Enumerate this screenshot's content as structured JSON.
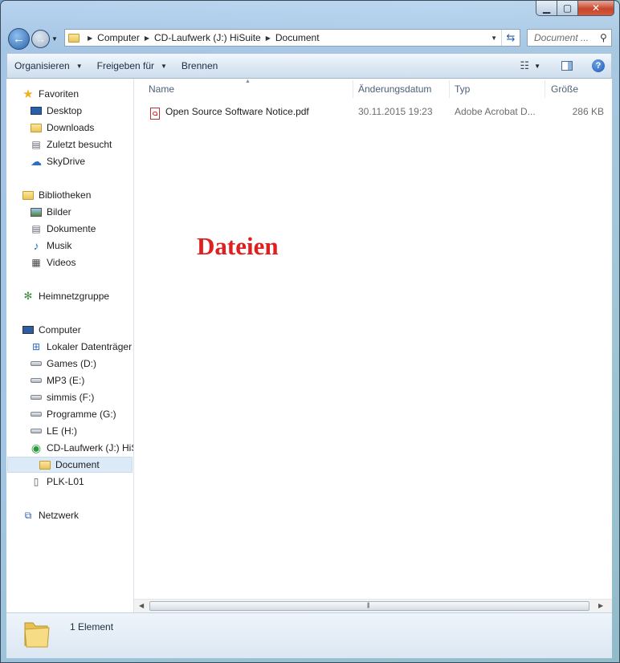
{
  "window": {
    "minimize_icon": "minimize-icon",
    "maximize_icon": "maximize-icon",
    "close_icon": "close-icon"
  },
  "address_bar": {
    "breadcrumbs": [
      "Computer",
      "CD-Laufwerk (J:) HiSuite",
      "Document"
    ]
  },
  "search": {
    "placeholder": "Document ..."
  },
  "toolbar": {
    "organize_label": "Organisieren",
    "share_label": "Freigeben für",
    "burn_label": "Brennen"
  },
  "sidebar": {
    "favorites": {
      "label": "Favoriten",
      "items": [
        "Desktop",
        "Downloads",
        "Zuletzt besucht",
        "SkyDrive"
      ]
    },
    "libraries": {
      "label": "Bibliotheken",
      "items": [
        "Bilder",
        "Dokumente",
        "Musik",
        "Videos"
      ]
    },
    "homegroup": {
      "label": "Heimnetzgruppe"
    },
    "computer": {
      "label": "Computer",
      "items": [
        "Lokaler Datenträger",
        "Games (D:)",
        "MP3 (E:)",
        "simmis (F:)",
        "Programme (G:)",
        "LE (H:)",
        "CD-Laufwerk (J:) HiSuite",
        "Document",
        "PLK-L01"
      ],
      "selected": "Document"
    },
    "network": {
      "label": "Netzwerk"
    }
  },
  "file_list": {
    "columns": [
      "Name",
      "Änderungsdatum",
      "Typ",
      "Größe"
    ],
    "rows": [
      {
        "name": "Open Source Software Notice.pdf",
        "modified": "30.11.2015 19:23",
        "type": "Adobe Acrobat D...",
        "size": "286 KB"
      }
    ]
  },
  "overlay_text": "Dateien",
  "status": {
    "count_label": "1 Element"
  }
}
